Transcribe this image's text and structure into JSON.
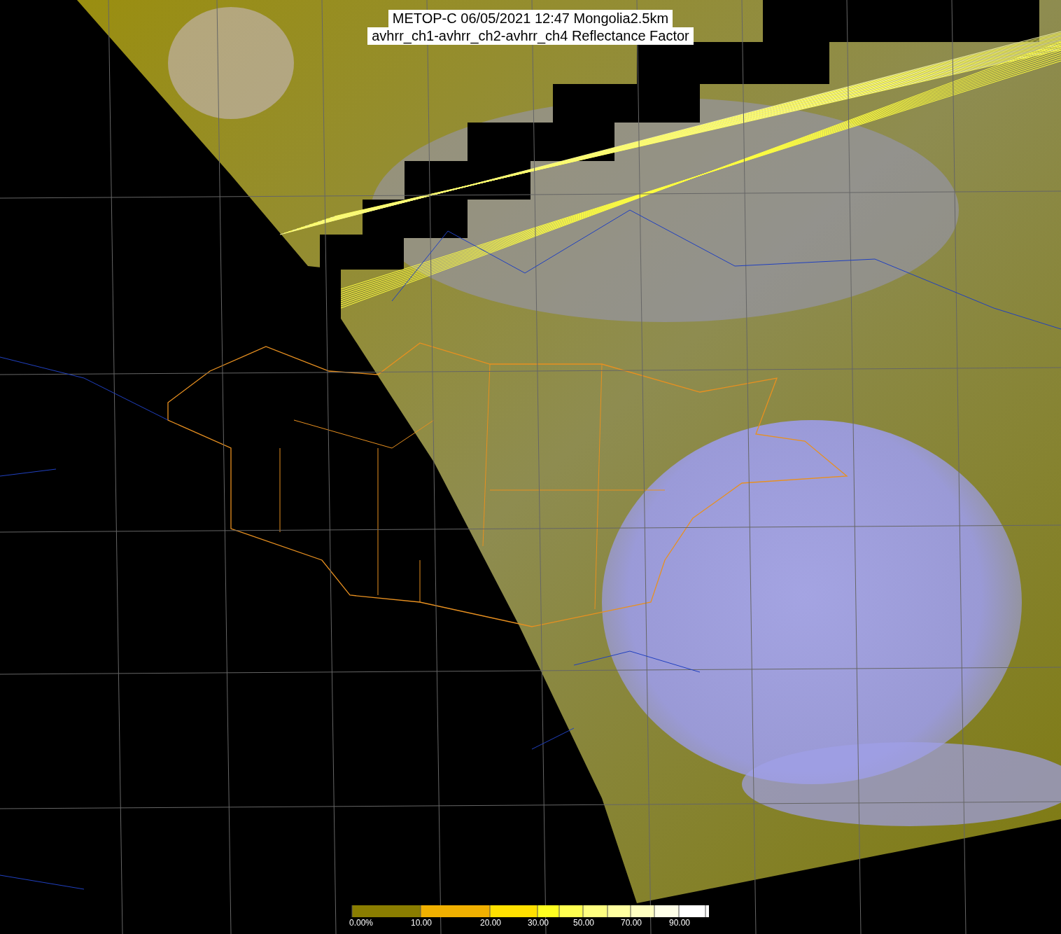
{
  "title": {
    "lines": [
      "METOP-C 06/05/2021 12:47 Mongolia2.5km",
      "avhrr_ch1-avhrr_ch2-avhrr_ch4 Reflectance Factor"
    ]
  },
  "colorbar": {
    "labels": [
      "0.00%",
      "10.00",
      "20.00",
      "30.00",
      "50.00",
      "70.00",
      "90.00"
    ]
  }
}
